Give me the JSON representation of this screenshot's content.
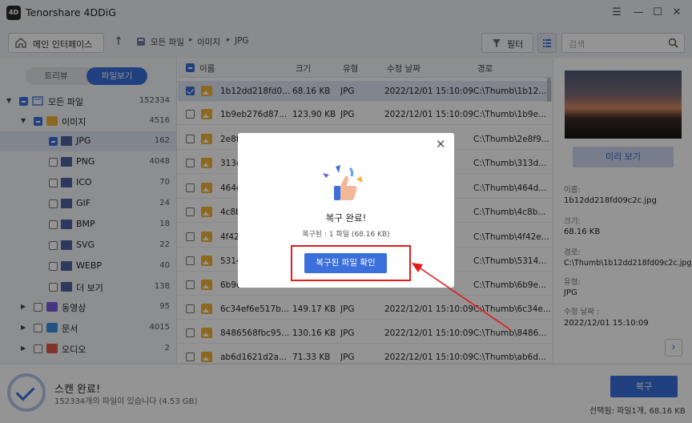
{
  "app": {
    "title": "Tenorshare 4DDiG",
    "logo_text": "4D"
  },
  "window_controls": [
    "menu",
    "minimize",
    "maximize",
    "close"
  ],
  "toolbar": {
    "home_label": "메인 인터페이스",
    "breadcrumb": [
      "모든 파일",
      "이미지",
      "JPG"
    ],
    "filter_label": "필터",
    "search_placeholder": "검색"
  },
  "sidebar": {
    "toggle": {
      "tree": "트리뷰",
      "file": "파일보기"
    },
    "tree": [
      {
        "label": "모든 파일",
        "count": "152334",
        "level": 0,
        "expanded": true,
        "checked": "partial"
      },
      {
        "label": "이미지",
        "count": "4516",
        "level": 1,
        "expanded": true,
        "checked": "partial"
      },
      {
        "label": "JPG",
        "count": "162",
        "level": 2,
        "checked": "partial",
        "selected": true
      },
      {
        "label": "PNG",
        "count": "4048",
        "level": 2,
        "checked": "none"
      },
      {
        "label": "ICO",
        "count": "70",
        "level": 2,
        "checked": "none"
      },
      {
        "label": "GIF",
        "count": "24",
        "level": 2,
        "checked": "none"
      },
      {
        "label": "BMP",
        "count": "18",
        "level": 2,
        "checked": "none"
      },
      {
        "label": "SVG",
        "count": "22",
        "level": 2,
        "checked": "none"
      },
      {
        "label": "WEBP",
        "count": "40",
        "level": 2,
        "checked": "none"
      },
      {
        "label": "더 보기",
        "count": "138",
        "level": 2,
        "checked": "none"
      },
      {
        "label": "동영상",
        "count": "95",
        "level": 1,
        "expanded": false,
        "checked": "none"
      },
      {
        "label": "문서",
        "count": "4015",
        "level": 1,
        "expanded": false,
        "checked": "none"
      },
      {
        "label": "오디오",
        "count": "2",
        "level": 1,
        "expanded": false,
        "checked": "none"
      }
    ]
  },
  "table": {
    "headers": [
      "이름",
      "크기",
      "유형",
      "수정 날짜",
      "경로"
    ],
    "rows": [
      {
        "name": "1b12dd218fd0...",
        "size": "68.16 KB",
        "type": "JPG",
        "date": "2022/12/01 15:10:09",
        "path": "C:\\Thumb\\1b12...",
        "checked": true
      },
      {
        "name": "1b9eb276d87...",
        "size": "123.90 KB",
        "type": "JPG",
        "date": "2022/12/01 15:10:09",
        "path": "C:\\Thumb\\1b9e...",
        "checked": false
      },
      {
        "name": "2e8f",
        "size": "",
        "type": "",
        "date": "",
        "path": "C:\\Thumb\\2e8f9...",
        "checked": false
      },
      {
        "name": "313c",
        "size": "",
        "type": "",
        "date": "",
        "path": "C:\\Thumb\\313d...",
        "checked": false
      },
      {
        "name": "464c",
        "size": "",
        "type": "",
        "date": "",
        "path": "C:\\Thumb\\464d...",
        "checked": false
      },
      {
        "name": "4c8b",
        "size": "",
        "type": "",
        "date": "",
        "path": "C:\\Thumb\\4c8b...",
        "checked": false
      },
      {
        "name": "4f42",
        "size": "",
        "type": "",
        "date": "",
        "path": "C:\\Thumb\\4f42e...",
        "checked": false
      },
      {
        "name": "5314",
        "size": "",
        "type": "",
        "date": "",
        "path": "C:\\Thumb\\5314...",
        "checked": false
      },
      {
        "name": "6b9e",
        "size": "",
        "type": "",
        "date": "",
        "path": "C:\\Thumb\\6b9e...",
        "checked": false
      },
      {
        "name": "6c34ef6e517b...",
        "size": "149.17 KB",
        "type": "JPG",
        "date": "2022/12/01 15:10:09",
        "path": "C:\\Thumb\\6c34e...",
        "checked": false
      },
      {
        "name": "8486568fbc95...",
        "size": "130.16 KB",
        "type": "JPG",
        "date": "2022/12/01 15:10:09",
        "path": "C:\\Thumb\\8486...",
        "checked": false
      },
      {
        "name": "ab6d1621d2a...",
        "size": "71.33 KB",
        "type": "JPG",
        "date": "2022/12/01 15:10:09",
        "path": "C:\\Thumb\\ab6d...",
        "checked": false
      }
    ]
  },
  "preview": {
    "button": "미리 보기",
    "name_label": "이름:",
    "name": "1b12dd218fd09c2c.jpg",
    "size_label": "크기:",
    "size": "68.16 KB",
    "path_label": "경로:",
    "path": "C:\\Thumb\\1b12dd218fd09c2c.jpg",
    "type_label": "유형:",
    "type": "JPG",
    "date_label": "수정 날짜 :",
    "date": "2022/12/01 15:10:09"
  },
  "footer": {
    "scan_title": "스캔 완료!",
    "scan_sub": "152334개의 파일이 있습니다 (4.53 GB)",
    "recover": "복구",
    "selection": "선택됨: 파일1개, 68.16 KB"
  },
  "modal": {
    "title": "복구 완료!",
    "subtitle": "복구된 : 1 파일 (68.16 KB)",
    "button": "복구된 파일 확인"
  },
  "colors": {
    "accent": "#3a6fdc",
    "highlight": "#e21b1b"
  }
}
